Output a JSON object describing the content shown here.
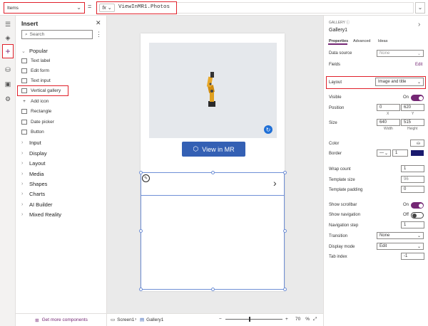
{
  "formula_bar": {
    "property": "Items",
    "equals": "=",
    "fx": "fx",
    "formula": "ViewInMR1.Photos"
  },
  "insert_panel": {
    "title": "Insert",
    "search_placeholder": "Search",
    "popular_label": "Popular",
    "popular_items": [
      "Text label",
      "Edit form",
      "Text input",
      "Vertical gallery",
      "Add icon",
      "Rectangle",
      "Date picker",
      "Button"
    ],
    "categories": [
      "Input",
      "Display",
      "Layout",
      "Media",
      "Shapes",
      "Charts",
      "AI Builder",
      "Mixed Reality"
    ],
    "get_more": "Get more components"
  },
  "canvas": {
    "button_label": "View in MR",
    "breadcrumb_screen": "Screen1",
    "breadcrumb_gallery": "Gallery1",
    "zoom_minus": "−",
    "zoom_plus": "+",
    "zoom_value": "70",
    "zoom_unit": "%"
  },
  "properties": {
    "type_label": "GALLERY",
    "name": "Gallery1",
    "tabs": [
      "Properties",
      "Advanced",
      "Ideas"
    ],
    "data_source_label": "Data source",
    "data_source_value": "None",
    "fields_label": "Fields",
    "fields_edit": "Edit",
    "layout_label": "Layout",
    "layout_value": "Image and title",
    "visible_label": "Visible",
    "visible_value": "On",
    "position_label": "Position",
    "position_x": "0",
    "position_y": "620",
    "x_label": "X",
    "y_label": "Y",
    "size_label": "Size",
    "size_width": "640",
    "size_height": "515",
    "width_label": "Width",
    "height_label": "Height",
    "color_label": "Color",
    "border_label": "Border",
    "border_width": "1",
    "wrap_count_label": "Wrap count",
    "wrap_count_value": "1",
    "template_size_label": "Template size",
    "template_size_value": "96",
    "template_padding_label": "Template padding",
    "template_padding_value": "0",
    "show_scrollbar_label": "Show scrollbar",
    "show_scrollbar_value": "On",
    "show_navigation_label": "Show navigation",
    "show_navigation_value": "Off",
    "navigation_step_label": "Navigation step",
    "navigation_step_value": "1",
    "transition_label": "Transition",
    "transition_value": "None",
    "display_mode_label": "Display mode",
    "display_mode_value": "Edit",
    "tab_index_label": "Tab index",
    "tab_index_value": "-1"
  },
  "colors": {
    "accent": "#742774",
    "highlight": "#e0202a",
    "button": "#3460b4",
    "border_color_swatch": "#1a1a6e"
  }
}
